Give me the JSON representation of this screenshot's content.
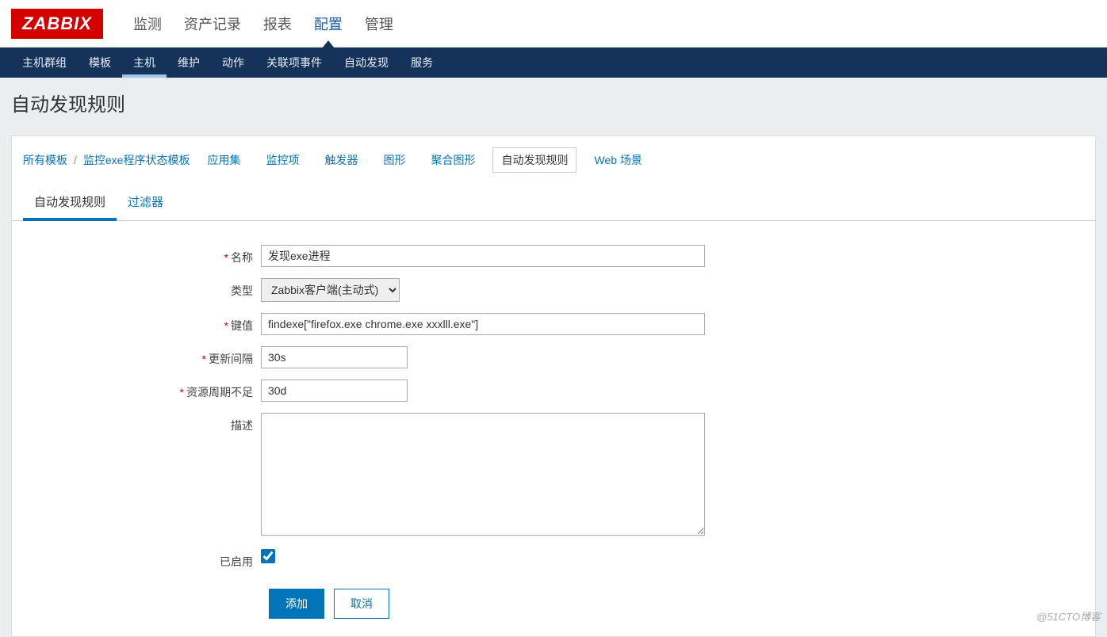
{
  "logo": "ZABBIX",
  "topNav": {
    "items": [
      {
        "label": "监测"
      },
      {
        "label": "资产记录"
      },
      {
        "label": "报表"
      },
      {
        "label": "配置",
        "active": true
      },
      {
        "label": "管理"
      }
    ]
  },
  "subNav": {
    "items": [
      {
        "label": "主机群组"
      },
      {
        "label": "模板"
      },
      {
        "label": "主机",
        "active": true
      },
      {
        "label": "维护"
      },
      {
        "label": "动作"
      },
      {
        "label": "关联项事件"
      },
      {
        "label": "自动发现"
      },
      {
        "label": "服务"
      }
    ]
  },
  "pageTitle": "自动发现规则",
  "breadcrumb": {
    "root": "所有模板",
    "sep": "/",
    "template": "监控exe程序状态模板",
    "tabs": [
      {
        "label": "应用集"
      },
      {
        "label": "监控项"
      },
      {
        "label": "触发器"
      },
      {
        "label": "图形"
      },
      {
        "label": "聚合图形"
      },
      {
        "label": "自动发现规则",
        "selected": true
      },
      {
        "label": "Web 场景"
      }
    ]
  },
  "innerTabs": [
    {
      "label": "自动发现规则",
      "active": true
    },
    {
      "label": "过滤器"
    }
  ],
  "form": {
    "name": {
      "label": "名称",
      "required": true,
      "value": "发现exe进程"
    },
    "type": {
      "label": "类型",
      "required": false,
      "value": "Zabbix客户端(主动式)"
    },
    "key": {
      "label": "键值",
      "required": true,
      "value": "findexe[\"firefox.exe chrome.exe xxxlll.exe\"]"
    },
    "update_interval": {
      "label": "更新间隔",
      "required": true,
      "value": "30s"
    },
    "keep_lost": {
      "label": "资源周期不足",
      "required": true,
      "value": "30d"
    },
    "description": {
      "label": "描述",
      "required": false,
      "value": ""
    },
    "enabled": {
      "label": "已启用",
      "value": true
    }
  },
  "buttons": {
    "add": "添加",
    "cancel": "取消"
  },
  "watermark": "@51CTO博客"
}
